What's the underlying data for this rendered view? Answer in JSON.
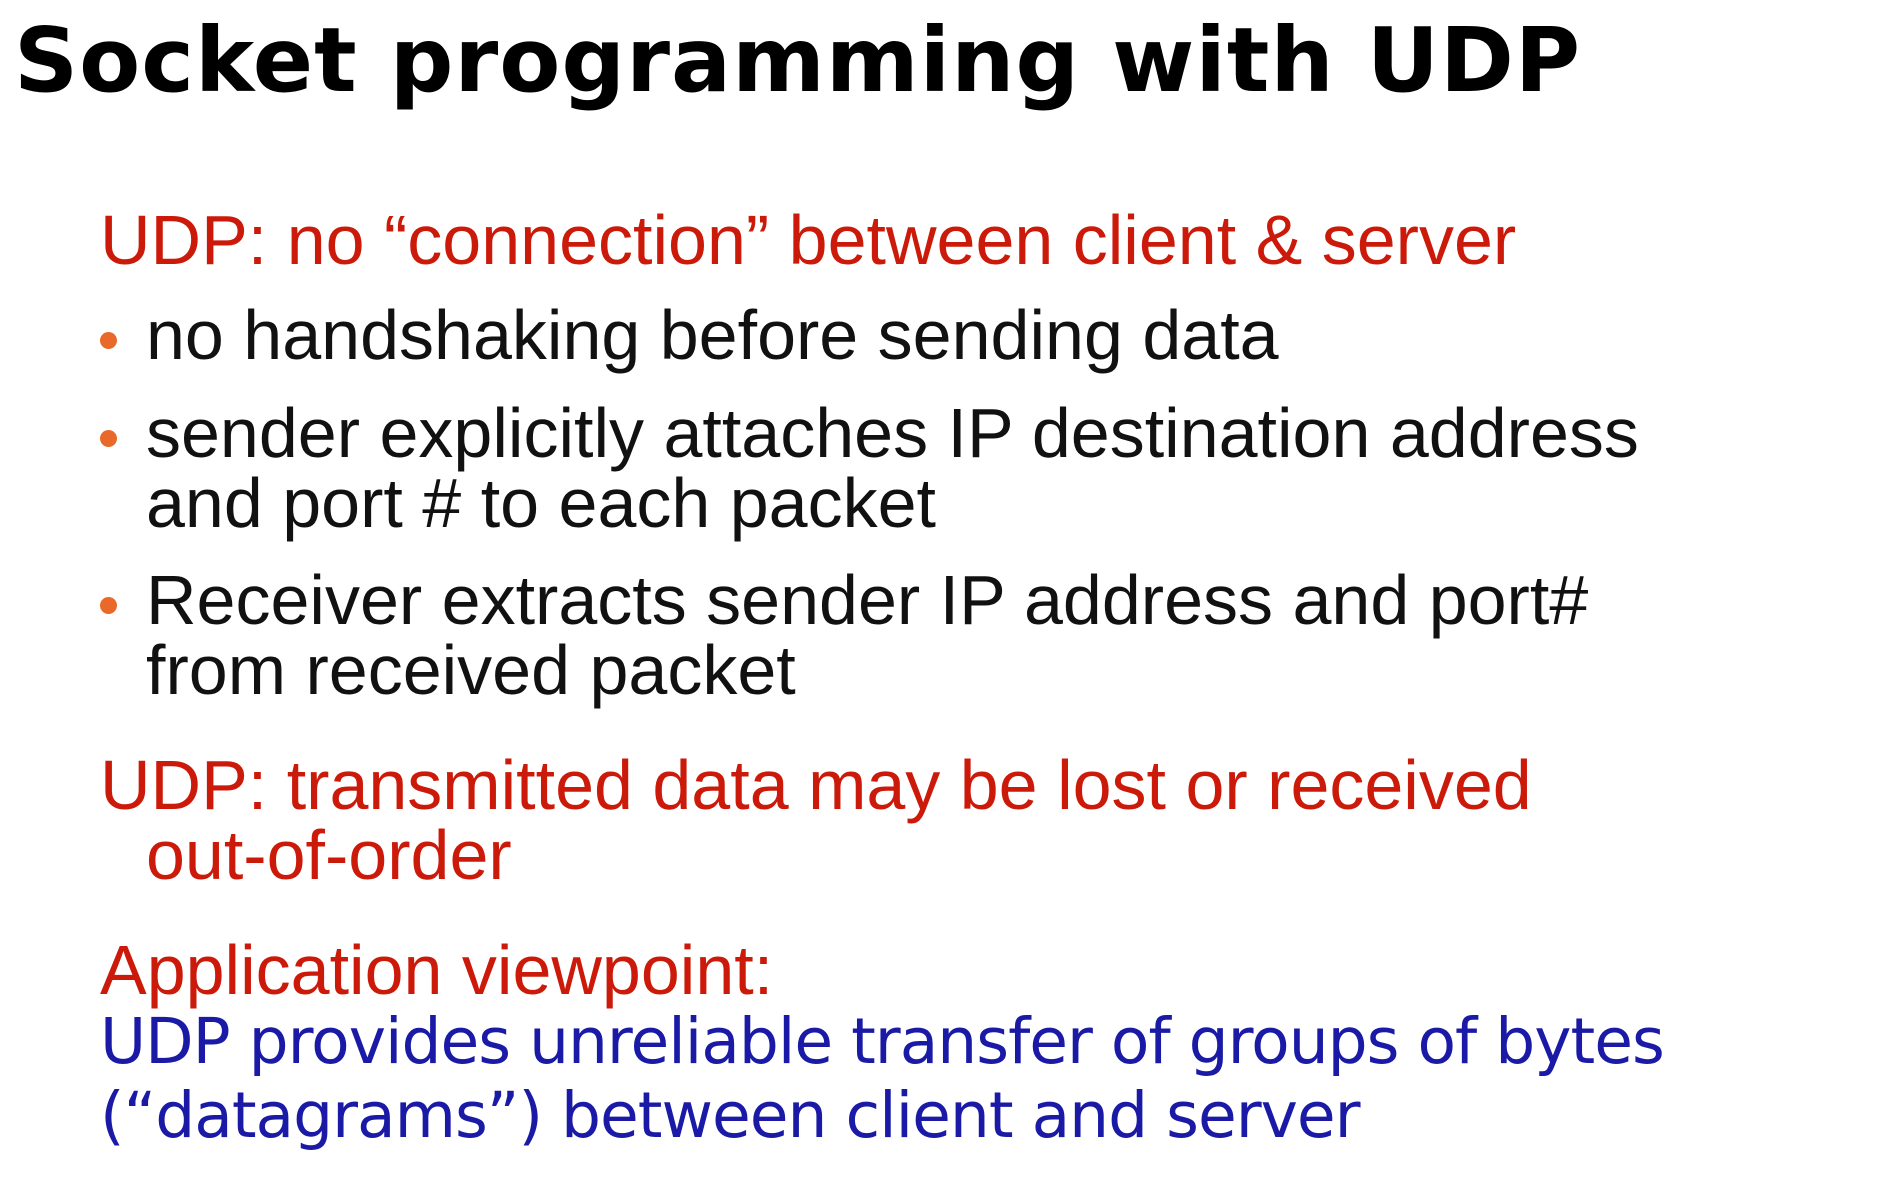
{
  "slide": {
    "title": "Socket programming with UDP",
    "section1": {
      "heading": "UDP: no “connection” between client & server",
      "bullets": [
        {
          "line1": "no handshaking before sending data",
          "line2": ""
        },
        {
          "line1": "sender explicitly attaches IP destination address",
          "line2": "and port # to each packet"
        },
        {
          "line1": "Receiver extracts sender IP address and port#",
          "line2": "from received packet"
        }
      ]
    },
    "section2": {
      "line1": "UDP: transmitted data may be lost or received",
      "line2": "out-of-order"
    },
    "section3": {
      "heading": "Application viewpoint:",
      "body_line1": "UDP provides unreliable transfer of groups of bytes",
      "body_line2": "(“datagrams”)  between client and server"
    },
    "colors": {
      "heading_red": "#cc1a0a",
      "bullet_orange": "#e8692a",
      "body_blue": "#1a1aa6",
      "text_black": "#111111"
    }
  }
}
